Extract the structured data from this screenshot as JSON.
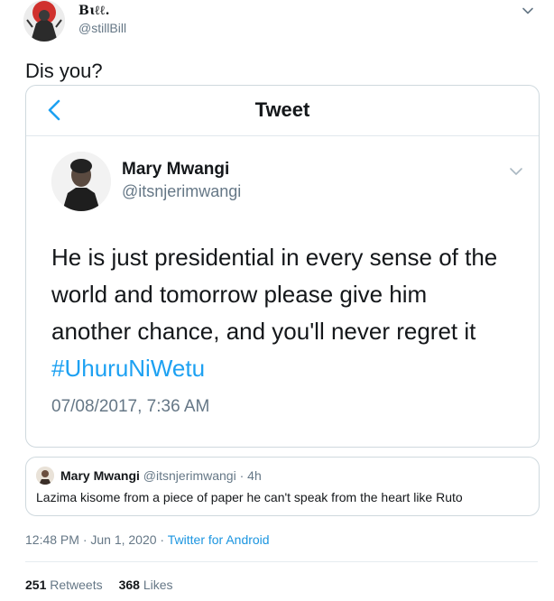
{
  "tweet": {
    "author": {
      "display_name": "Bɩℓℓ.",
      "handle": "@stillBill"
    },
    "text": "Dis you?",
    "timestamp": "12:48 PM · Jun 1, 2020",
    "separator": " · ",
    "source": "Twitter for Android",
    "stats": {
      "retweets_count": "251",
      "retweets_label": "Retweets",
      "likes_count": "368",
      "likes_label": "Likes"
    }
  },
  "screenshot": {
    "header_title": "Tweet",
    "author": {
      "name": "Mary Mwangi",
      "handle": "@itsnjerimwangi"
    },
    "body_lines": [
      "He is just presidential in every sense of the",
      "world and tomorrow please give him",
      "another chance, and you'll never regret it"
    ],
    "hashtag": "#UhuruNiWetu",
    "timestamp": "07/08/2017, 7:36 AM"
  },
  "quoted_tweet": {
    "name": "Mary Mwangi",
    "handle": "@itsnjerimwangi",
    "age": "· 4h",
    "text": "Lazima kisome from a piece of paper he can't speak from the heart like Ruto"
  },
  "colors": {
    "accent": "#1da1f2",
    "link": "#1b95e0",
    "muted": "#657786",
    "border": "#cfd9de",
    "text": "#14171a"
  },
  "icons": {
    "top_menu": "chevron-down-icon",
    "back": "chevron-left-icon",
    "inner_menu": "chevron-down-icon"
  }
}
